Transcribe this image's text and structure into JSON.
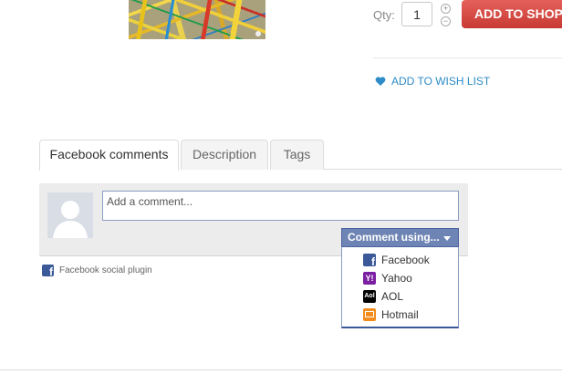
{
  "product": {
    "image_alt": "product-image"
  },
  "cart": {
    "qty_label": "Qty:",
    "qty_value": "1",
    "plus": "+",
    "minus": "−",
    "add_to_cart": "ADD TO SHOPPING CART"
  },
  "wishlist": {
    "label": "ADD TO WISH LIST",
    "icon": "heart-icon",
    "color": "#2d8bc7"
  },
  "tabs": [
    {
      "label": "Facebook comments",
      "active": true
    },
    {
      "label": "Description",
      "active": false
    },
    {
      "label": "Tags",
      "active": false
    }
  ],
  "facebook": {
    "comment_placeholder": "Add a comment...",
    "comment_using": "Comment using...",
    "providers": [
      {
        "label": "Facebook",
        "icon": "facebook-icon"
      },
      {
        "label": "Yahoo",
        "icon": "yahoo-icon"
      },
      {
        "label": "AOL",
        "icon": "aol-icon"
      },
      {
        "label": "Hotmail",
        "icon": "hotmail-icon"
      }
    ],
    "plugin_label": "Facebook social plugin",
    "accent": "#3b5998",
    "button_color": "#6d84b4"
  },
  "colors": {
    "cart_button": "#d94b43"
  }
}
